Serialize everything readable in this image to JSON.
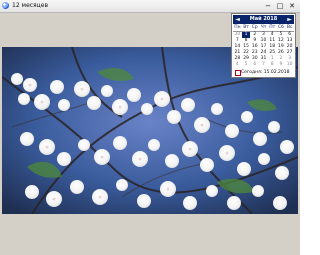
{
  "window": {
    "title": "12 месяцев",
    "controls": {
      "minimize": "−",
      "maximize": "□",
      "close": "✕"
    }
  },
  "calendar": {
    "month_label": "Май 2018",
    "prev": "◄",
    "next": "►",
    "weekdays": [
      "Пн",
      "Вт",
      "Ср",
      "Чт",
      "Пт",
      "Сб",
      "Вс"
    ],
    "days": [
      {
        "d": "30",
        "other": true
      },
      {
        "d": "1"
      },
      {
        "d": "2"
      },
      {
        "d": "3"
      },
      {
        "d": "4"
      },
      {
        "d": "5"
      },
      {
        "d": "6"
      },
      {
        "d": "7"
      },
      {
        "d": "8"
      },
      {
        "d": "9"
      },
      {
        "d": "10"
      },
      {
        "d": "11"
      },
      {
        "d": "12"
      },
      {
        "d": "13"
      },
      {
        "d": "14"
      },
      {
        "d": "15"
      },
      {
        "d": "16"
      },
      {
        "d": "17"
      },
      {
        "d": "18"
      },
      {
        "d": "19"
      },
      {
        "d": "20"
      },
      {
        "d": "21"
      },
      {
        "d": "22"
      },
      {
        "d": "23"
      },
      {
        "d": "24"
      },
      {
        "d": "25"
      },
      {
        "d": "26"
      },
      {
        "d": "27"
      },
      {
        "d": "28"
      },
      {
        "d": "29"
      },
      {
        "d": "30"
      },
      {
        "d": "31"
      },
      {
        "d": "1",
        "other": true
      },
      {
        "d": "2",
        "other": true
      },
      {
        "d": "3",
        "other": true
      },
      {
        "d": "4",
        "other": true
      },
      {
        "d": "5",
        "other": true
      },
      {
        "d": "6",
        "other": true
      },
      {
        "d": "7",
        "other": true
      },
      {
        "d": "8",
        "other": true
      },
      {
        "d": "9",
        "other": true
      },
      {
        "d": "10",
        "other": true
      }
    ],
    "selected_day": "1",
    "today_label": "Сегодня: 15.02.2018"
  },
  "colors": {
    "accent": "#0a246a",
    "today_border": "#b00020"
  },
  "image": {
    "semantic": "cherry-blossom-photo"
  }
}
